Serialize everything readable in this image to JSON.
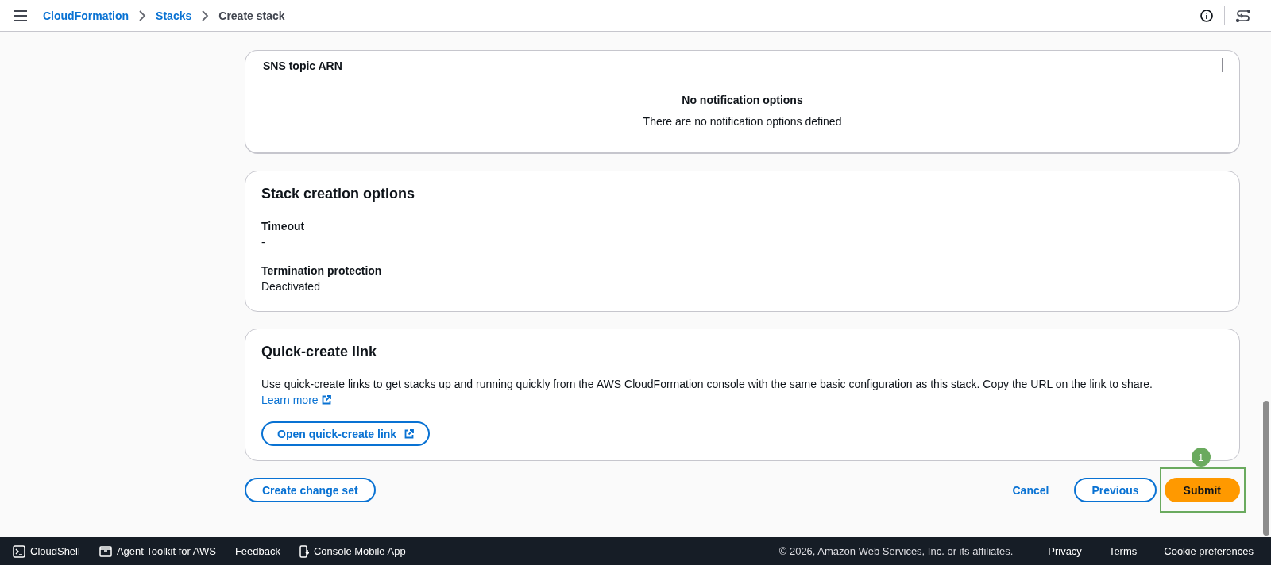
{
  "header": {
    "breadcrumbs": [
      {
        "label": "CloudFormation",
        "kind": "link"
      },
      {
        "label": "Stacks",
        "kind": "link"
      },
      {
        "label": "Create stack",
        "kind": "current"
      }
    ]
  },
  "notification_table": {
    "columns": [
      "SNS topic ARN"
    ],
    "empty_title": "No notification options",
    "empty_text": "There are no notification options defined"
  },
  "stack_creation_options": {
    "title": "Stack creation options",
    "fields": [
      {
        "label": "Timeout",
        "value": "-"
      },
      {
        "label": "Termination protection",
        "value": "Deactivated"
      }
    ]
  },
  "quick_create": {
    "title": "Quick-create link",
    "text": "Use quick-create links to get stacks up and running quickly from the AWS CloudFormation console with the same basic configuration as this stack. Copy the URL on the link to share.",
    "link": "Learn more",
    "button": "Open quick-create link"
  },
  "actions": {
    "secondary": "Create change set",
    "buttons": [
      {
        "label": "Cancel",
        "kind": "link"
      },
      {
        "label": "Previous",
        "kind": "normal"
      },
      {
        "label": "Submit",
        "kind": "primary"
      }
    ]
  },
  "annotation": {
    "label": "1"
  },
  "footer": {
    "left": [
      {
        "label": "CloudShell",
        "kind": "terminal"
      },
      {
        "label": "Agent Toolkit for AWS",
        "kind": "toolkit"
      },
      {
        "label": "Feedback",
        "kind": "plain"
      },
      {
        "label": "Console Mobile App",
        "kind": "phone"
      }
    ],
    "copyright": "© 2026, Amazon Web Services, Inc. or its affiliates.",
    "links": [
      "Privacy",
      "Terms",
      "Cookie preferences"
    ]
  }
}
